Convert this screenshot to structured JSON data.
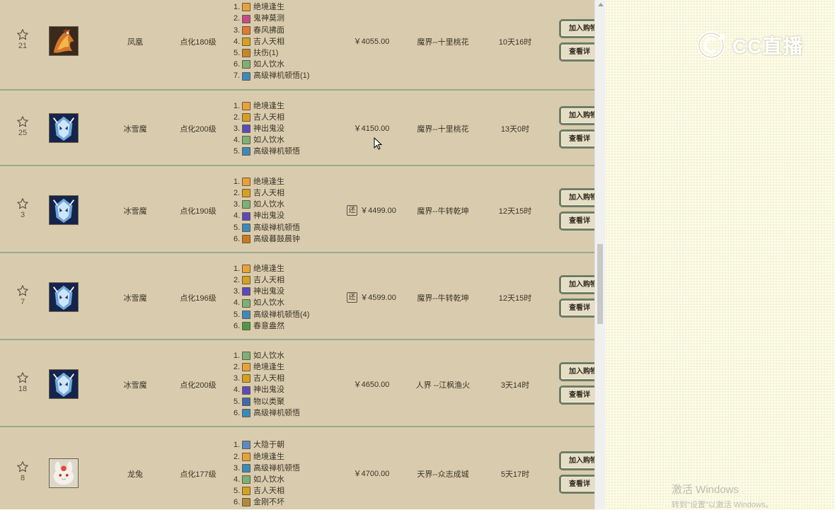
{
  "buttons": {
    "add_to_cart": "加入购物",
    "view_details": "查看详"
  },
  "return_badge": "还",
  "logo": {
    "text": "CC直播"
  },
  "watermark": {
    "title": "激活 Windows",
    "subtitle": "转到\"设置\"以激活 Windows。"
  },
  "rows": [
    {
      "favorites": "21",
      "pet_name": "凤凰",
      "level": "点化180级",
      "avatar": "phoenix",
      "skills": [
        {
          "n": "1.",
          "name": "绝境逢生",
          "color": "#e8a23a"
        },
        {
          "n": "2.",
          "name": "鬼神莫测",
          "color": "#c94a8a"
        },
        {
          "n": "3.",
          "name": "春风拂面",
          "color": "#e07a30"
        },
        {
          "n": "4.",
          "name": "吉人天相",
          "color": "#d6a020"
        },
        {
          "n": "5.",
          "name": "扶伤(1)",
          "color": "#c8862a"
        },
        {
          "n": "6.",
          "name": "如人饮水",
          "color": "#7ab07a"
        },
        {
          "n": "7.",
          "name": "高级禅机顿悟(1)",
          "color": "#3a8ac0"
        }
      ],
      "price": "￥4055.00",
      "has_return": false,
      "server": "魔界--十里桃花",
      "time_left": "10天16时"
    },
    {
      "favorites": "25",
      "pet_name": "冰雪魔",
      "level": "点化200级",
      "avatar": "ice",
      "skills": [
        {
          "n": "1.",
          "name": "绝境逢生",
          "color": "#e8a23a"
        },
        {
          "n": "2.",
          "name": "吉人天相",
          "color": "#d6a020"
        },
        {
          "n": "3.",
          "name": "神出鬼没",
          "color": "#5a4ac0"
        },
        {
          "n": "4.",
          "name": "如人饮水",
          "color": "#7ab07a"
        },
        {
          "n": "5.",
          "name": "高级禅机顿悟",
          "color": "#3a8ac0"
        }
      ],
      "price": "￥4150.00",
      "has_return": false,
      "server": "魔界--十里桃花",
      "time_left": "13天0时"
    },
    {
      "favorites": "3",
      "pet_name": "冰雪魔",
      "level": "点化190级",
      "avatar": "ice",
      "skills": [
        {
          "n": "1.",
          "name": "绝境逢生",
          "color": "#e8a23a"
        },
        {
          "n": "2.",
          "name": "吉人天相",
          "color": "#d6a020"
        },
        {
          "n": "3.",
          "name": "如人饮水",
          "color": "#7ab07a"
        },
        {
          "n": "4.",
          "name": "神出鬼没",
          "color": "#5a4ac0"
        },
        {
          "n": "5.",
          "name": "高级禅机顿悟",
          "color": "#3a8ac0"
        },
        {
          "n": "6.",
          "name": "高级暮鼓晨钟",
          "color": "#c87a20"
        }
      ],
      "price": "￥4499.00",
      "has_return": true,
      "server": "魔界--牛转乾坤",
      "time_left": "12天15时"
    },
    {
      "favorites": "7",
      "pet_name": "冰雪魔",
      "level": "点化196级",
      "avatar": "ice",
      "skills": [
        {
          "n": "1.",
          "name": "绝境逢生",
          "color": "#e8a23a"
        },
        {
          "n": "2.",
          "name": "吉人天相",
          "color": "#d6a020"
        },
        {
          "n": "3.",
          "name": "神出鬼没",
          "color": "#5a4ac0"
        },
        {
          "n": "4.",
          "name": "如人饮水",
          "color": "#7ab07a"
        },
        {
          "n": "5.",
          "name": "高级禅机顿悟(4)",
          "color": "#3a8ac0"
        },
        {
          "n": "6.",
          "name": "春意盎然",
          "color": "#4a9a4a"
        }
      ],
      "price": "￥4599.00",
      "has_return": true,
      "server": "魔界--牛转乾坤",
      "time_left": "12天15时"
    },
    {
      "favorites": "18",
      "pet_name": "冰雪魔",
      "level": "点化200级",
      "avatar": "ice",
      "skills": [
        {
          "n": "1.",
          "name": "如人饮水",
          "color": "#7ab07a"
        },
        {
          "n": "2.",
          "name": "绝境逢生",
          "color": "#e8a23a"
        },
        {
          "n": "3.",
          "name": "吉人天相",
          "color": "#d6a020"
        },
        {
          "n": "4.",
          "name": "神出鬼没",
          "color": "#5a4ac0"
        },
        {
          "n": "5.",
          "name": "物以类聚",
          "color": "#3a6ab0"
        },
        {
          "n": "6.",
          "name": "高级禅机顿悟",
          "color": "#3a8ac0"
        }
      ],
      "price": "￥4650.00",
      "has_return": false,
      "server": "人界 --江枫渔火",
      "time_left": "3天14时"
    },
    {
      "favorites": "8",
      "pet_name": "龙兔",
      "level": "点化177级",
      "avatar": "rabbit",
      "skills": [
        {
          "n": "1.",
          "name": "大隐于朝",
          "color": "#5a8ac8"
        },
        {
          "n": "2.",
          "name": "绝境逢生",
          "color": "#e8a23a"
        },
        {
          "n": "3.",
          "name": "高级禅机顿悟",
          "color": "#3a8ac0"
        },
        {
          "n": "4.",
          "name": "如人饮水",
          "color": "#7ab07a"
        },
        {
          "n": "5.",
          "name": "吉人天相",
          "color": "#d6a020"
        },
        {
          "n": "6.",
          "name": "金刚不坏",
          "color": "#b08a3a"
        }
      ],
      "price": "￥4700.00",
      "has_return": false,
      "server": "天界--众志成城",
      "time_left": "5天17时"
    }
  ]
}
